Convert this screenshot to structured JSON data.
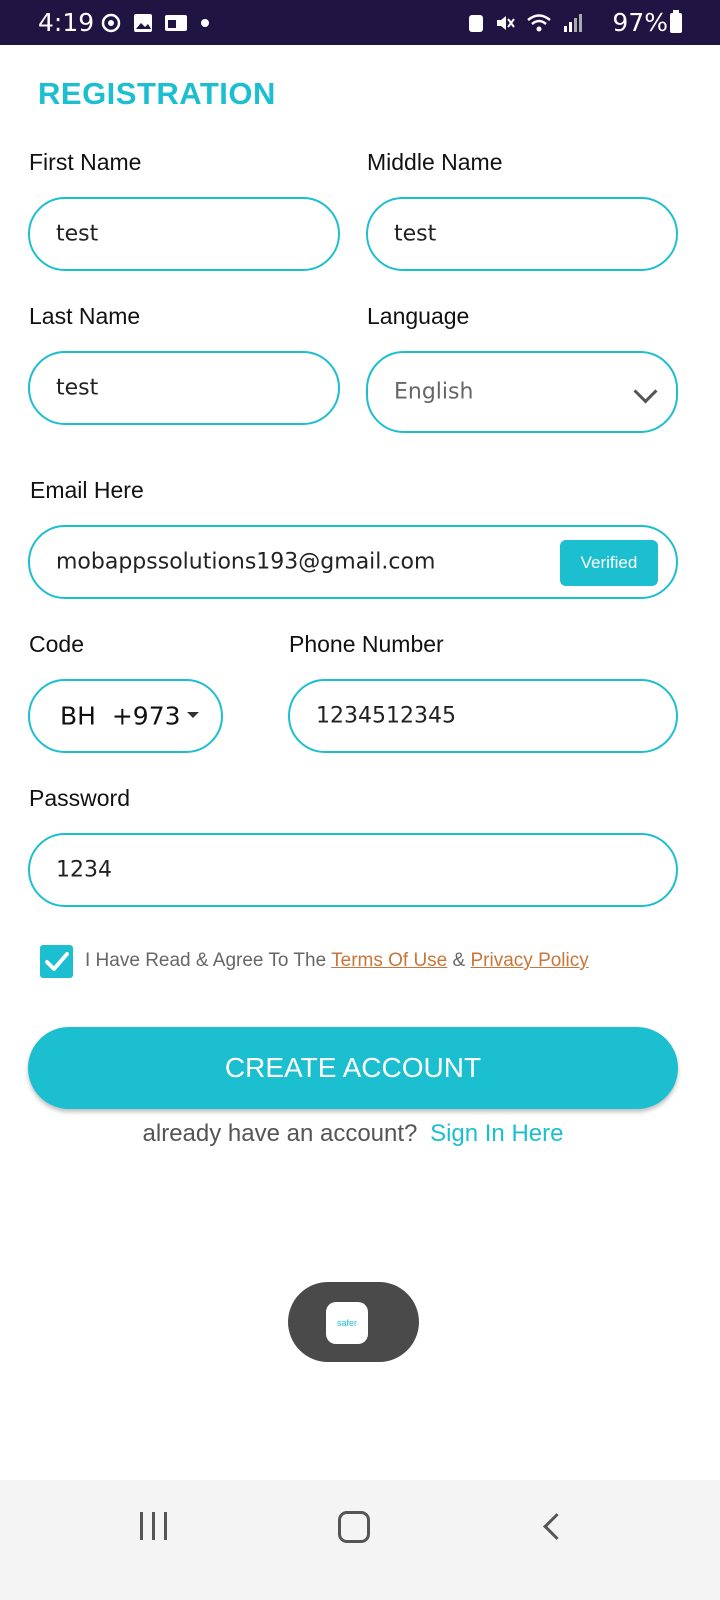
{
  "status_bar": {
    "time": "4:19",
    "battery": "97%",
    "icons_left": [
      "sync-icon",
      "image-icon",
      "card-icon",
      "dot-icon"
    ],
    "icons_right": [
      "recycle-icon",
      "mute-icon",
      "wifi-icon",
      "signal-icon",
      "battery-icon"
    ]
  },
  "page": {
    "title": "REGISTRATION"
  },
  "form": {
    "first_name": {
      "label": "First Name",
      "value": "test"
    },
    "middle_name": {
      "label": "Middle Name",
      "value": "test"
    },
    "last_name": {
      "label": "Last Name",
      "value": "test"
    },
    "language": {
      "label": "Language",
      "value": "English"
    },
    "email": {
      "label": "Email Here",
      "value": "mobappssolutions193@gmail.com",
      "badge": "Verified"
    },
    "code": {
      "label": "Code",
      "country": "BH",
      "dial": "+973"
    },
    "phone": {
      "label": "Phone Number",
      "value": "1234512345"
    },
    "password": {
      "label": "Password",
      "value": "1234"
    }
  },
  "terms": {
    "prefix": "I Have Read & Agree To The",
    "terms_link": "Terms Of Use",
    "amp": "&",
    "privacy_link": "Privacy Policy",
    "checked": true
  },
  "actions": {
    "create_account": "CREATE ACCOUNT",
    "signin_prompt": "already have an account?",
    "signin_link": "Sign In Here"
  },
  "toast": {
    "logo_text": "safer"
  },
  "colors": {
    "accent": "#1cbfcf",
    "link": "#c8763a",
    "status_bar": "#1f1442"
  }
}
